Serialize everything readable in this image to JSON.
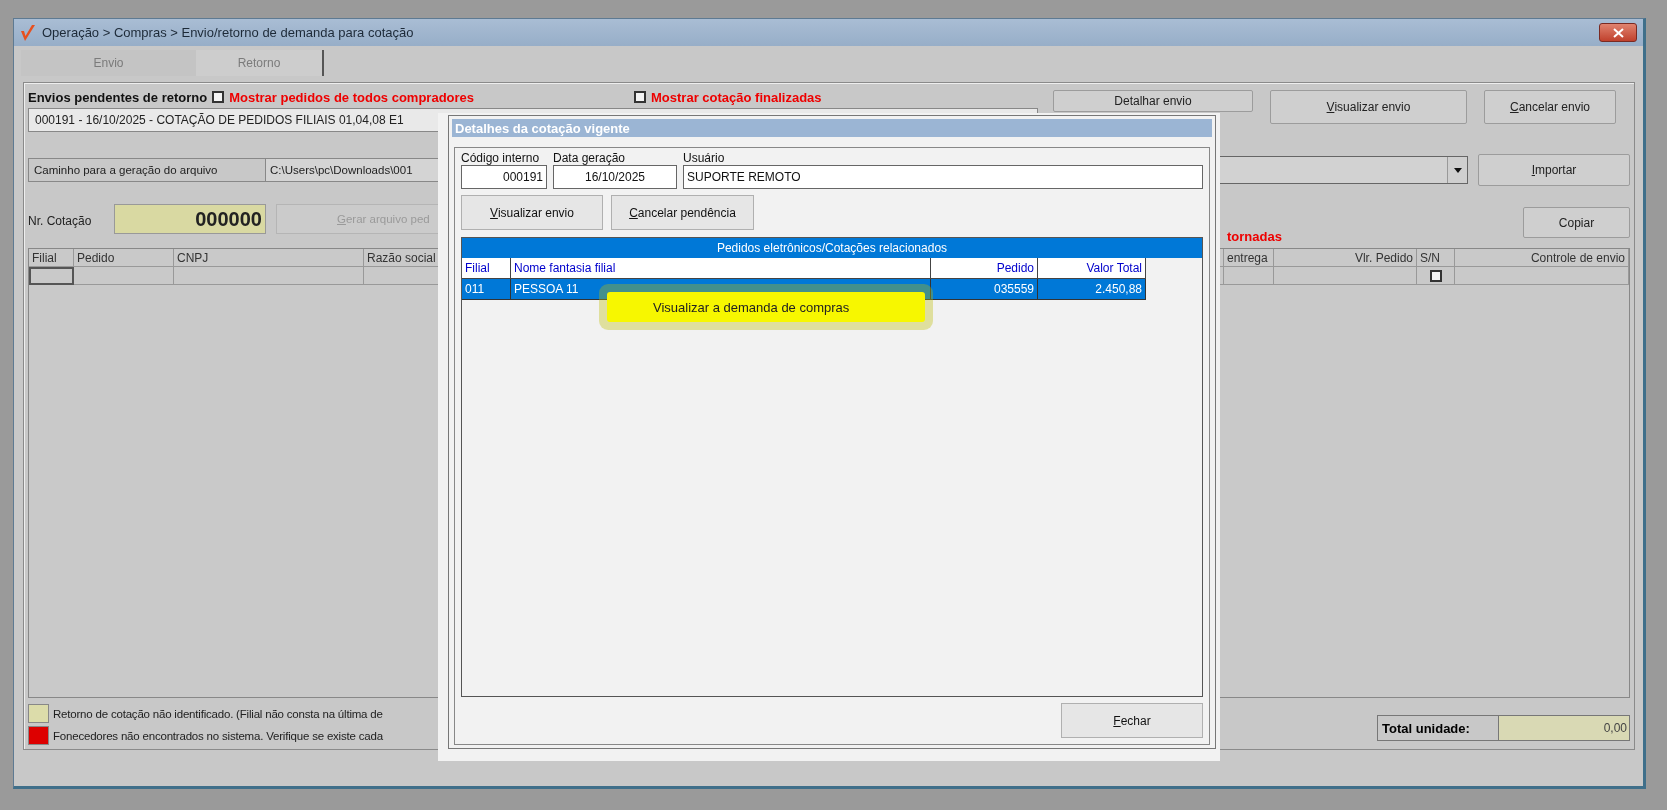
{
  "window": {
    "title": "Operação > Compras > Envio/retorno de demanda para cotação"
  },
  "tabs": [
    {
      "label": "Envio",
      "selected": false
    },
    {
      "label": "Retorno",
      "selected": true
    }
  ],
  "panel": {
    "heading": "Envios pendentes de retorno",
    "show_all_buyers": {
      "label": "Mostrar pedidos de todos compradores",
      "checked": false
    },
    "show_finished": {
      "label": "Mostrar cotação finalizadas",
      "checked": false
    },
    "pending_combo": {
      "value": "000191 - 16/10/2025 - COTAÇÃO DE PEDIDOS FILIAIS 01,04,08 E1"
    },
    "buttons": [
      {
        "label": "Detalhar envio",
        "mnemonic": false
      },
      {
        "label": "Visualizar envio",
        "mnemonic": true
      },
      {
        "label": "Cancelar envio",
        "mnemonic": true
      }
    ],
    "path": {
      "label": "Caminho para a geração do arquivo",
      "value": "C:\\Users\\pc\\Downloads\\001"
    },
    "import_button": {
      "label": "Importar",
      "mnemonic": true
    },
    "quote_number": {
      "label": "Nr. Cotação",
      "value": "000000"
    },
    "generate_button": {
      "label": "Gerar arquivo ped",
      "mnemonic": true,
      "disabled": true
    },
    "returned_label": "tornadas",
    "copy_button": {
      "label": "Copiar",
      "mnemonic": false
    },
    "grid": {
      "columns": [
        "Filial",
        "Pedido",
        "CNPJ",
        "Razão social",
        "entrega",
        "Vlr. Pedido",
        "S/N",
        "Controle de envio"
      ],
      "rows": [
        {
          "checked": false
        }
      ]
    },
    "legend": [
      {
        "text": "Retorno de cotação não identificado. (Filial não consta na última de",
        "color": "#dcdcaa"
      },
      {
        "text": "Fonecedores não encontrados no sistema. Verifique se existe cada",
        "color": "#dd0000"
      }
    ],
    "total": {
      "label": "Total unidade:",
      "value": "0,00"
    }
  },
  "dialog": {
    "title": "Detalhes da cotação vigente",
    "fields": [
      {
        "label": "Código interno",
        "value": "000191"
      },
      {
        "label": "Data geração",
        "value": "16/10/2025"
      },
      {
        "label": "Usuário",
        "value": "SUPORTE REMOTO"
      }
    ],
    "buttons": [
      {
        "label": "Visualizar envio",
        "mnemonic": true
      },
      {
        "label": "Cancelar pendência",
        "mnemonic": true
      }
    ],
    "table": {
      "caption": "Pedidos eletrônicos/Cotações relacionados",
      "columns": [
        "Filial",
        "Nome fantasia filial",
        "Pedido",
        "Valor Total"
      ],
      "rows": [
        {
          "cells": [
            "011",
            "PESSOA 11",
            "035559",
            "2.450,88"
          ],
          "selected": true
        }
      ]
    },
    "tooltip": "Visualizar a demanda de compras",
    "close_button": {
      "label": "Fechar",
      "mnemonic": true
    }
  }
}
